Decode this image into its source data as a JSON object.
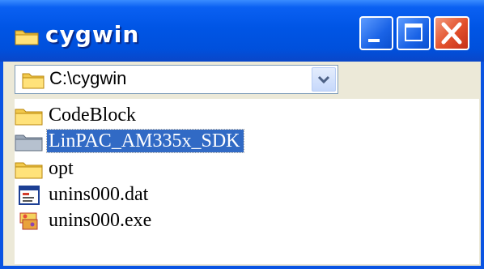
{
  "window": {
    "title": "cygwin"
  },
  "address": {
    "value": "C:\\cygwin"
  },
  "colors": {
    "titlebar": "#0055e5",
    "selection": "#316ac5",
    "folder": "#f2c94c",
    "close": "#e2502b"
  },
  "items": [
    {
      "name": "CodeBlock",
      "icon": "folder-icon",
      "selected": false
    },
    {
      "name": "LinPAC_AM335x_SDK",
      "icon": "folder-icon",
      "selected": true
    },
    {
      "name": "opt",
      "icon": "folder-icon",
      "selected": false
    },
    {
      "name": "unins000.dat",
      "icon": "file-dat-icon",
      "selected": false
    },
    {
      "name": "unins000.exe",
      "icon": "installer-exe-icon",
      "selected": false
    }
  ]
}
